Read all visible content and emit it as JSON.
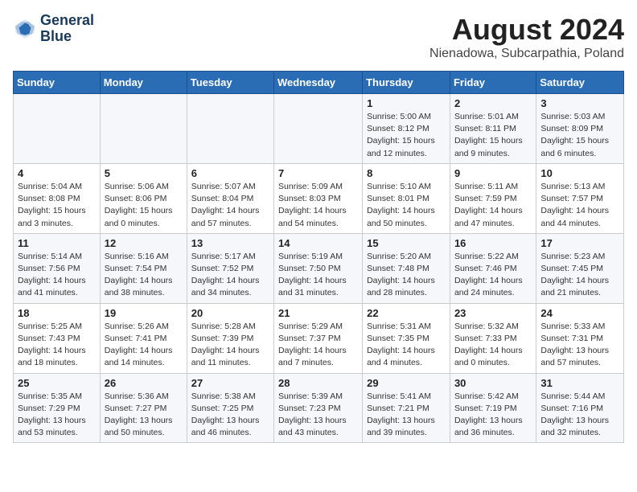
{
  "header": {
    "logo_line1": "General",
    "logo_line2": "Blue",
    "month_year": "August 2024",
    "location": "Nienadowa, Subcarpathia, Poland"
  },
  "weekdays": [
    "Sunday",
    "Monday",
    "Tuesday",
    "Wednesday",
    "Thursday",
    "Friday",
    "Saturday"
  ],
  "weeks": [
    [
      {
        "day": "",
        "info": ""
      },
      {
        "day": "",
        "info": ""
      },
      {
        "day": "",
        "info": ""
      },
      {
        "day": "",
        "info": ""
      },
      {
        "day": "1",
        "info": "Sunrise: 5:00 AM\nSunset: 8:12 PM\nDaylight: 15 hours and 12 minutes."
      },
      {
        "day": "2",
        "info": "Sunrise: 5:01 AM\nSunset: 8:11 PM\nDaylight: 15 hours and 9 minutes."
      },
      {
        "day": "3",
        "info": "Sunrise: 5:03 AM\nSunset: 8:09 PM\nDaylight: 15 hours and 6 minutes."
      }
    ],
    [
      {
        "day": "4",
        "info": "Sunrise: 5:04 AM\nSunset: 8:08 PM\nDaylight: 15 hours and 3 minutes."
      },
      {
        "day": "5",
        "info": "Sunrise: 5:06 AM\nSunset: 8:06 PM\nDaylight: 15 hours and 0 minutes."
      },
      {
        "day": "6",
        "info": "Sunrise: 5:07 AM\nSunset: 8:04 PM\nDaylight: 14 hours and 57 minutes."
      },
      {
        "day": "7",
        "info": "Sunrise: 5:09 AM\nSunset: 8:03 PM\nDaylight: 14 hours and 54 minutes."
      },
      {
        "day": "8",
        "info": "Sunrise: 5:10 AM\nSunset: 8:01 PM\nDaylight: 14 hours and 50 minutes."
      },
      {
        "day": "9",
        "info": "Sunrise: 5:11 AM\nSunset: 7:59 PM\nDaylight: 14 hours and 47 minutes."
      },
      {
        "day": "10",
        "info": "Sunrise: 5:13 AM\nSunset: 7:57 PM\nDaylight: 14 hours and 44 minutes."
      }
    ],
    [
      {
        "day": "11",
        "info": "Sunrise: 5:14 AM\nSunset: 7:56 PM\nDaylight: 14 hours and 41 minutes."
      },
      {
        "day": "12",
        "info": "Sunrise: 5:16 AM\nSunset: 7:54 PM\nDaylight: 14 hours and 38 minutes."
      },
      {
        "day": "13",
        "info": "Sunrise: 5:17 AM\nSunset: 7:52 PM\nDaylight: 14 hours and 34 minutes."
      },
      {
        "day": "14",
        "info": "Sunrise: 5:19 AM\nSunset: 7:50 PM\nDaylight: 14 hours and 31 minutes."
      },
      {
        "day": "15",
        "info": "Sunrise: 5:20 AM\nSunset: 7:48 PM\nDaylight: 14 hours and 28 minutes."
      },
      {
        "day": "16",
        "info": "Sunrise: 5:22 AM\nSunset: 7:46 PM\nDaylight: 14 hours and 24 minutes."
      },
      {
        "day": "17",
        "info": "Sunrise: 5:23 AM\nSunset: 7:45 PM\nDaylight: 14 hours and 21 minutes."
      }
    ],
    [
      {
        "day": "18",
        "info": "Sunrise: 5:25 AM\nSunset: 7:43 PM\nDaylight: 14 hours and 18 minutes."
      },
      {
        "day": "19",
        "info": "Sunrise: 5:26 AM\nSunset: 7:41 PM\nDaylight: 14 hours and 14 minutes."
      },
      {
        "day": "20",
        "info": "Sunrise: 5:28 AM\nSunset: 7:39 PM\nDaylight: 14 hours and 11 minutes."
      },
      {
        "day": "21",
        "info": "Sunrise: 5:29 AM\nSunset: 7:37 PM\nDaylight: 14 hours and 7 minutes."
      },
      {
        "day": "22",
        "info": "Sunrise: 5:31 AM\nSunset: 7:35 PM\nDaylight: 14 hours and 4 minutes."
      },
      {
        "day": "23",
        "info": "Sunrise: 5:32 AM\nSunset: 7:33 PM\nDaylight: 14 hours and 0 minutes."
      },
      {
        "day": "24",
        "info": "Sunrise: 5:33 AM\nSunset: 7:31 PM\nDaylight: 13 hours and 57 minutes."
      }
    ],
    [
      {
        "day": "25",
        "info": "Sunrise: 5:35 AM\nSunset: 7:29 PM\nDaylight: 13 hours and 53 minutes."
      },
      {
        "day": "26",
        "info": "Sunrise: 5:36 AM\nSunset: 7:27 PM\nDaylight: 13 hours and 50 minutes."
      },
      {
        "day": "27",
        "info": "Sunrise: 5:38 AM\nSunset: 7:25 PM\nDaylight: 13 hours and 46 minutes."
      },
      {
        "day": "28",
        "info": "Sunrise: 5:39 AM\nSunset: 7:23 PM\nDaylight: 13 hours and 43 minutes."
      },
      {
        "day": "29",
        "info": "Sunrise: 5:41 AM\nSunset: 7:21 PM\nDaylight: 13 hours and 39 minutes."
      },
      {
        "day": "30",
        "info": "Sunrise: 5:42 AM\nSunset: 7:19 PM\nDaylight: 13 hours and 36 minutes."
      },
      {
        "day": "31",
        "info": "Sunrise: 5:44 AM\nSunset: 7:16 PM\nDaylight: 13 hours and 32 minutes."
      }
    ]
  ]
}
